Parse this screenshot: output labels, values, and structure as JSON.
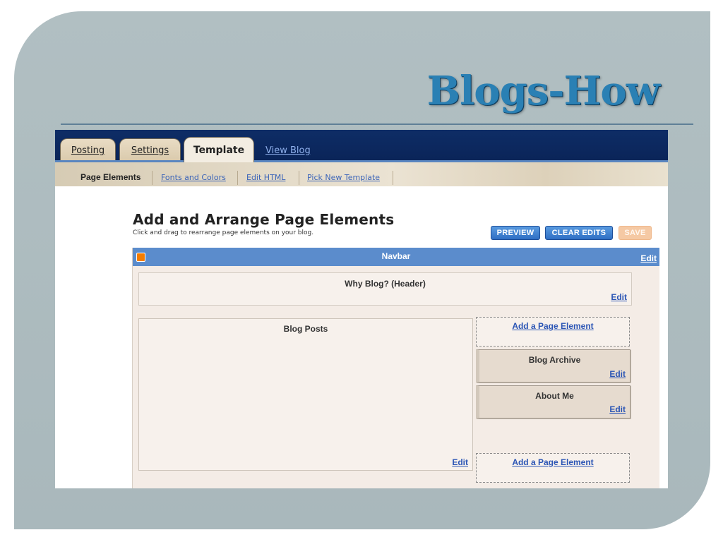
{
  "slide": {
    "title": "Blogs-How"
  },
  "tabs": [
    {
      "label": "Posting",
      "active": false
    },
    {
      "label": "Settings",
      "active": false
    },
    {
      "label": "Template",
      "active": true
    }
  ],
  "view_blog_link": "View Blog",
  "subnav": [
    {
      "label": "Page Elements",
      "current": true
    },
    {
      "label": "Fonts and Colors",
      "current": false
    },
    {
      "label": "Edit HTML",
      "current": false
    },
    {
      "label": "Pick New Template",
      "current": false
    }
  ],
  "page": {
    "heading": "Add and Arrange Page Elements",
    "subheading": "Click and drag to rearrange page elements on your blog."
  },
  "buttons": {
    "preview": "PREVIEW",
    "clear_edits": "CLEAR EDITS",
    "save": "SAVE"
  },
  "layout": {
    "navbar": {
      "label": "Navbar",
      "edit": "Edit"
    },
    "header": {
      "label": "Why Blog? (Header)",
      "edit": "Edit"
    },
    "blog_posts": {
      "label": "Blog Posts",
      "edit": "Edit"
    },
    "sidebar": {
      "add_top": "Add a Page Element",
      "widgets": [
        {
          "label": "Blog Archive",
          "edit": "Edit"
        },
        {
          "label": "About Me",
          "edit": "Edit"
        }
      ],
      "add_bottom": "Add a Page Element"
    }
  },
  "colors": {
    "slide_bg": "#b1bfc2",
    "title": "#2a80b4",
    "topbar": "#0e2d66",
    "navbar": "#5b8ccc",
    "link": "#2b55b5",
    "save_disabled": "#f5c9a4"
  }
}
